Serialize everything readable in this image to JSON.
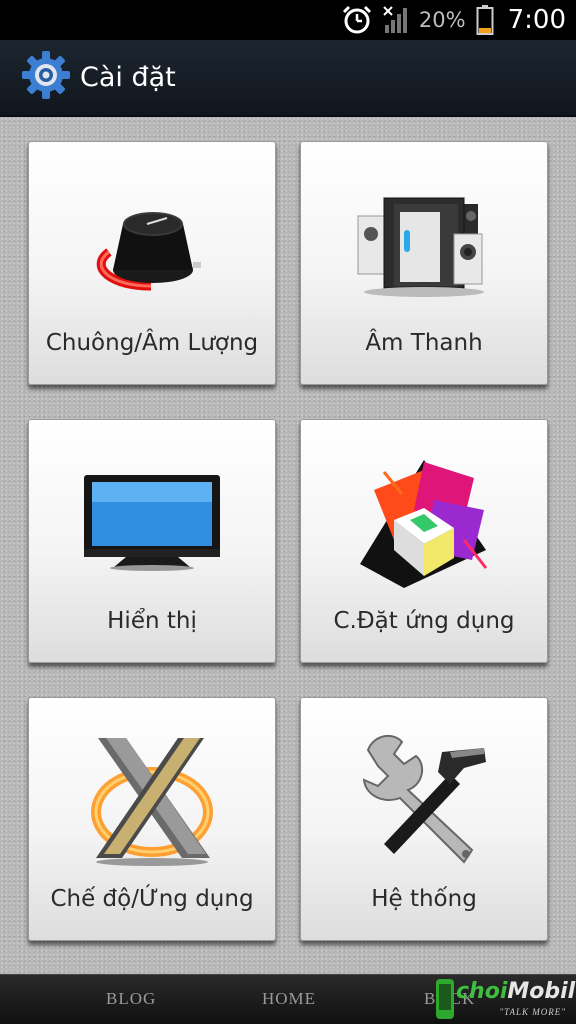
{
  "status_bar": {
    "battery_percent": "20%",
    "time": "7:00",
    "icons": [
      "alarm-clock-icon",
      "signal-icon",
      "battery-icon"
    ]
  },
  "action_bar": {
    "title": "Cài đặt",
    "icon": "settings-gear-icon"
  },
  "tiles": [
    {
      "label": "Chuông/Âm Lượng",
      "icon": "volume-knob-icon"
    },
    {
      "label": "Âm Thanh",
      "icon": "speakers-icon"
    },
    {
      "label": "Hiển thị",
      "icon": "monitor-icon"
    },
    {
      "label": "C.Đặt ứng dụng",
      "icon": "cubes-icon"
    },
    {
      "label": "Chế độ/Ứng dụng",
      "icon": "x-logo-icon"
    },
    {
      "label": "Hệ thống",
      "icon": "tools-icon"
    }
  ],
  "bottom_nav": {
    "items": [
      "BLOG",
      "HOME",
      "BACK"
    ]
  },
  "watermark": {
    "brand_a": "choi",
    "brand_b": "Mobile",
    "tagline": "\"TALK MORE\""
  },
  "colors": {
    "action_bar": "#151c24",
    "background": "#b8b8b8",
    "tile": "#f4f4f4"
  }
}
